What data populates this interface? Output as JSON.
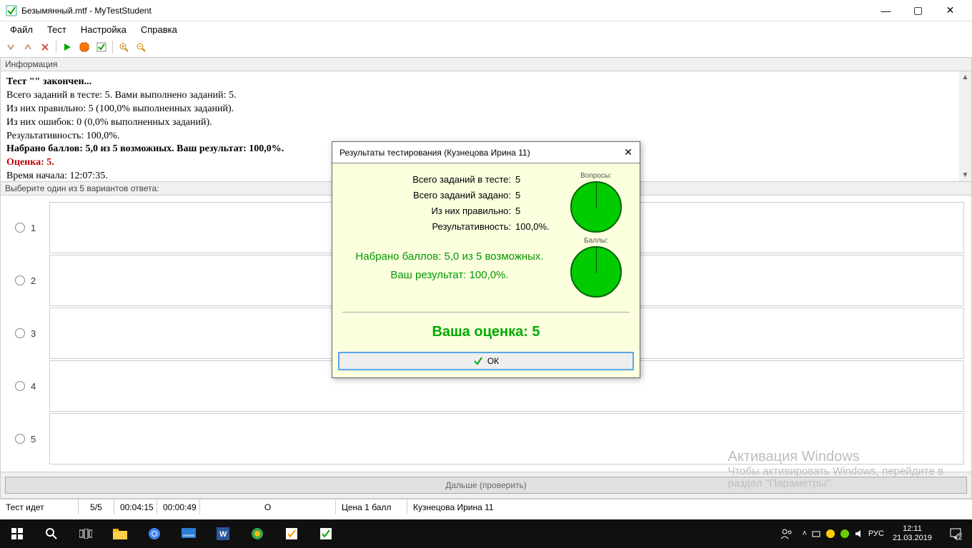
{
  "window": {
    "title": "Безымянный.mtf - MyTestStudent",
    "min": "—",
    "max": "▢",
    "close": "✕"
  },
  "menu": {
    "items": [
      "Файл",
      "Тест",
      "Настройка",
      "Справка"
    ]
  },
  "info": {
    "header": "Информация",
    "l1": "Тест \"\" закончен...",
    "l2": "Всего заданий в тесте: 5. Вами выполнено заданий: 5.",
    "l3": "Из них правильно: 5 (100,0% выполненных заданий).",
    "l4": "Из них ошибок: 0 (0,0% выполненных заданий).",
    "l5": "Результативность: 100,0%.",
    "l6": "Набрано баллов: 5,0 из 5 возможных. Ваш результат: 100,0%.",
    "l7": "Оценка: 5.",
    "l8": "Время начала: 12:07:35."
  },
  "prompt": "Выберите один из 5 вариантов ответа:",
  "answers": [
    "1",
    "2",
    "3",
    "4",
    "5"
  ],
  "next_btn": "Дальше (проверить)",
  "status": {
    "s1": "Тест идет",
    "s2": "5/5",
    "s3": "00:04:15",
    "s4": "00:00:49",
    "s5": "О",
    "s6": "Цена 1 балл",
    "s7": "Кузнецова Ирина 11"
  },
  "dialog": {
    "title": "Результаты тестирования (Кузнецова Ирина 11)",
    "rows": [
      {
        "label": "Всего заданий в тесте:",
        "val": "5"
      },
      {
        "label": "Всего заданий задано:",
        "val": "5"
      },
      {
        "label": "Из них правильно:",
        "val": "5"
      },
      {
        "label": "Результативность:",
        "val": "100,0%."
      }
    ],
    "pie1": "Вопросы:",
    "pie2": "Баллы:",
    "score1": "Набрано баллов: 5,0 из 5 возможных.",
    "score2": "Ваш результат: 100,0%.",
    "grade": "Ваша оценка: 5",
    "ok": "ОК"
  },
  "watermark": {
    "l1": "Активация Windows",
    "l2": "Чтобы активировать Windows, перейдите в",
    "l3": "раздел \"Параметры\"."
  },
  "taskbar": {
    "time": "12:11",
    "date": "21.03.2019",
    "lang": "РУС"
  }
}
